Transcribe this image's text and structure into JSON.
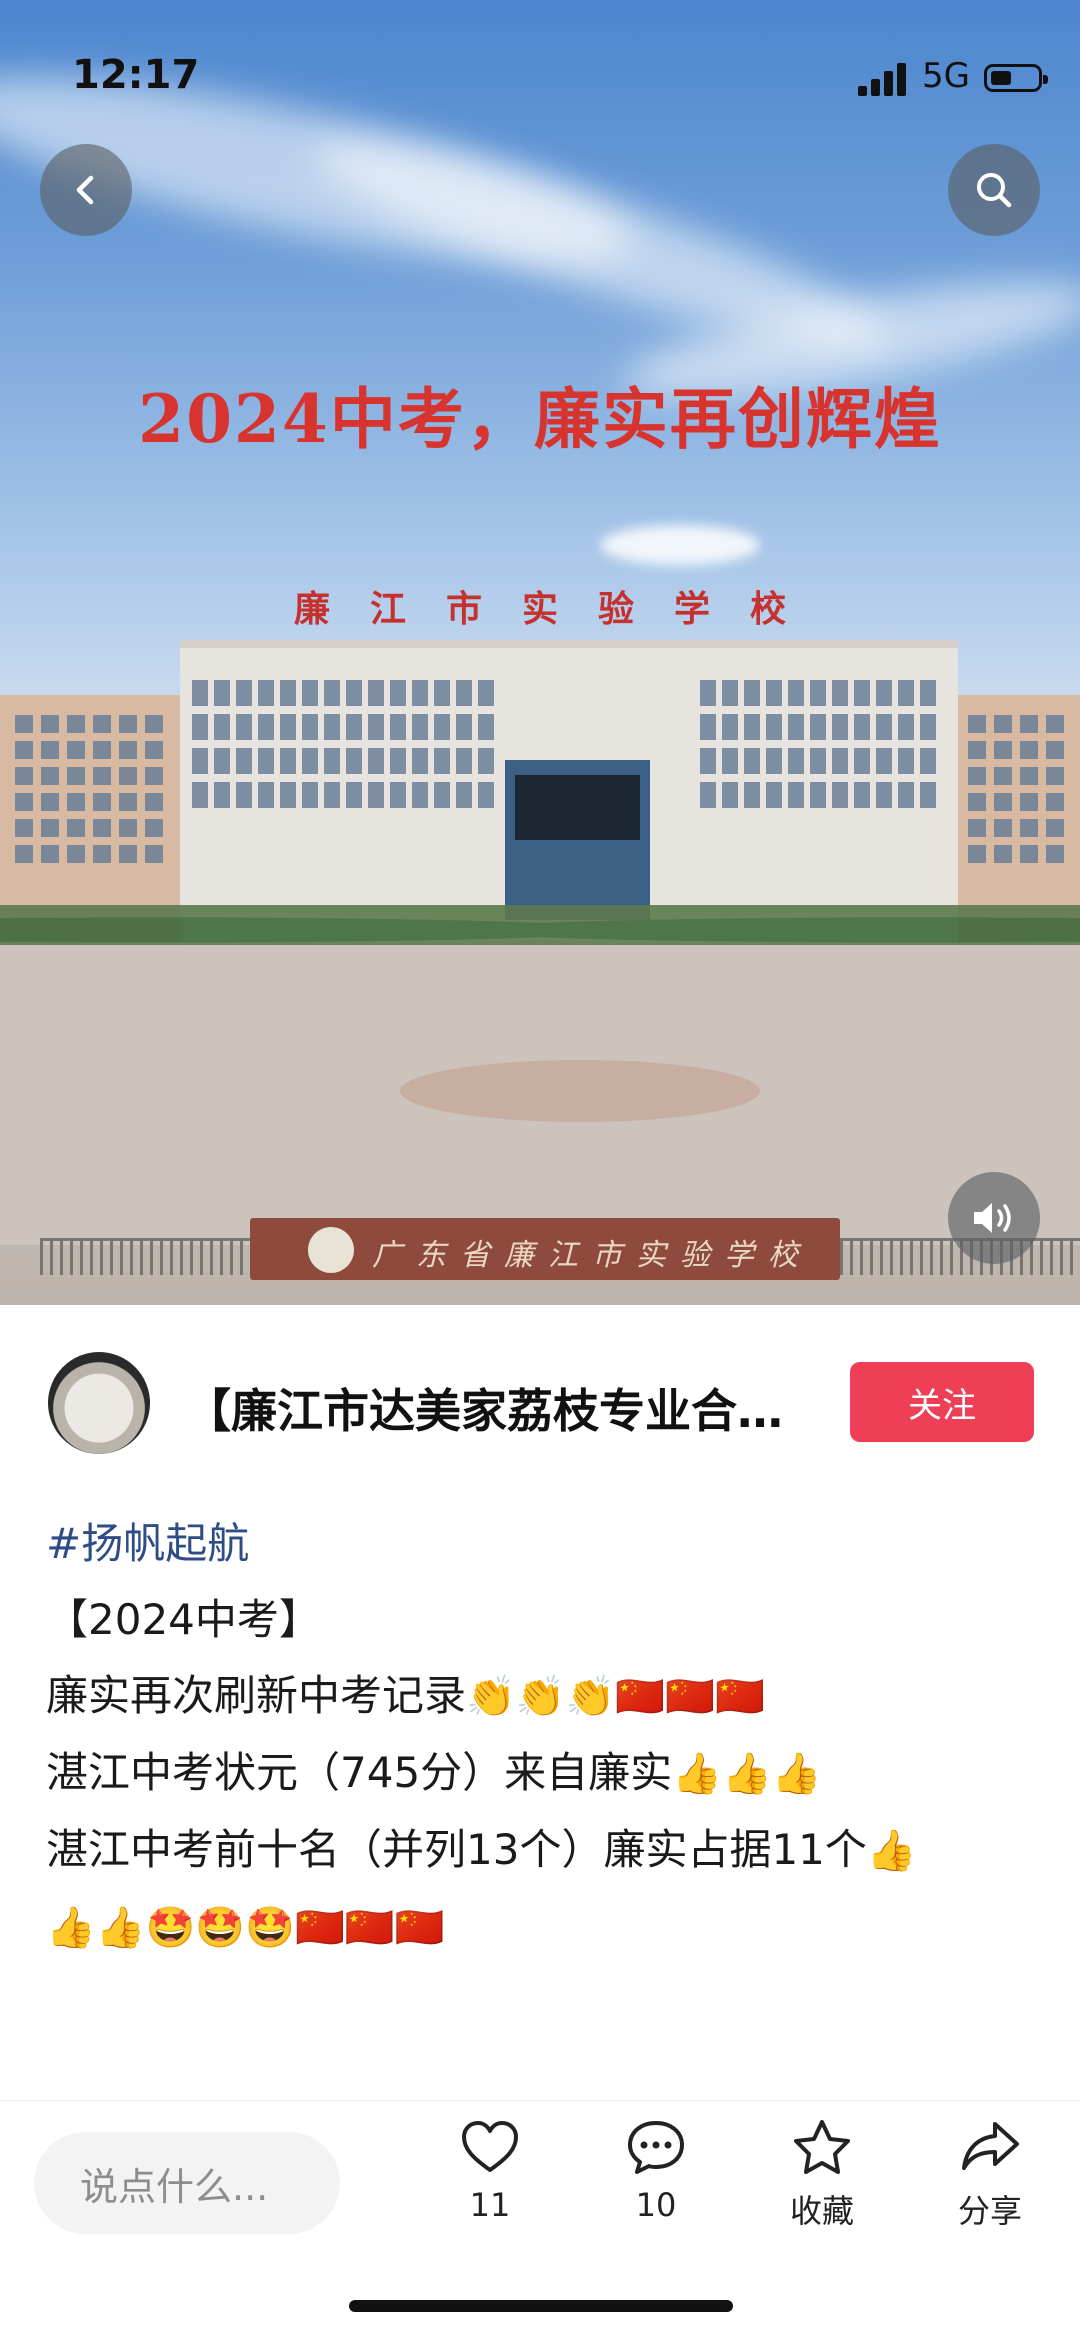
{
  "status_bar": {
    "time": "12:17",
    "network": "5G"
  },
  "hero": {
    "title": "2024中考，廉实再创辉煌",
    "roof_sign": "廉江市实验学校",
    "gate_sign": "广东省廉江市实验学校"
  },
  "author": {
    "name": "【廉江市达美家荔枝专业合…",
    "follow_label": "关注"
  },
  "post": {
    "hashtag": "#扬帆起航",
    "lines": [
      {
        "text": "【2024中考】",
        "emoji": ""
      },
      {
        "text": "廉实再次刷新中考记录",
        "emoji": "👏👏👏🇨🇳🇨🇳🇨🇳"
      },
      {
        "text": "湛江中考状元（745分）来自廉实",
        "emoji": "👍👍👍"
      },
      {
        "text": "湛江中考前十名（并列13个）廉实占据11个",
        "emoji": "👍"
      },
      {
        "text": "",
        "emoji": "👍👍🤩🤩🤩🇨🇳🇨🇳🇨🇳"
      }
    ]
  },
  "bottom_bar": {
    "comment_placeholder": "说点什么...",
    "like_count": "11",
    "comment_count": "10",
    "collect_label": "收藏",
    "share_label": "分享"
  },
  "colors": {
    "follow": "#ee3f56",
    "hashtag": "#2e4d86",
    "title_red": "#d8342f"
  },
  "icons": [
    "back-arrow-icon",
    "search-icon",
    "volume-icon",
    "heart-icon",
    "comment-icon",
    "star-icon",
    "share-icon"
  ]
}
